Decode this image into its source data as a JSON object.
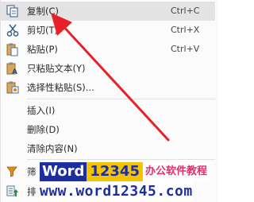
{
  "menu": {
    "items": [
      {
        "label": "复制(C)",
        "shortcut": "Ctrl+C",
        "icon": "copy-icon"
      },
      {
        "label": "剪切(T)",
        "shortcut": "Ctrl+X",
        "icon": "scissors-icon"
      },
      {
        "label": "粘贴(P)",
        "shortcut": "Ctrl+V",
        "icon": "paste-icon"
      },
      {
        "label": "只粘贴文本(Y)",
        "icon": "paste-text-icon"
      },
      {
        "label": "选择性粘贴(S)...",
        "icon": "paste-special-icon"
      },
      {
        "label": "插入(I)"
      },
      {
        "label": "删除(D)"
      },
      {
        "label": "清除内容(N)"
      },
      {
        "label": "筛",
        "icon": "filter-icon"
      },
      {
        "label": "排",
        "icon": "sort-icon"
      }
    ]
  },
  "watermark": {
    "word": "Word",
    "numbers": "12345",
    "tagline": "办公软件教程",
    "url": "www.word12345.com"
  },
  "colors": {
    "arrow": "#e8202a",
    "highlight": "#e3e3e3",
    "watermark_blue": "#1d2ea0",
    "watermark_yellow": "#f3c400",
    "watermark_pink": "#e0306a"
  }
}
